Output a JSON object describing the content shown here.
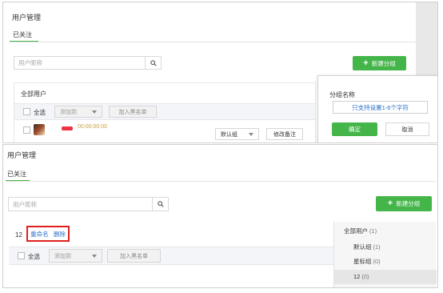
{
  "top": {
    "page_title": "用户管理",
    "tab_label": "已关注",
    "search_placeholder": "用户昵称",
    "new_group_label": "新建分组",
    "section_title": "全部用户",
    "select_all": "全选",
    "add_to": "添加到",
    "blacklist": "加入黑名单",
    "row": {
      "name_placeholder_digits": "00:00:00:00",
      "group_select": "默认组",
      "edit_note": "修改备注"
    },
    "popup": {
      "title": "分组名称",
      "input_value": "只支持设置1-6个字符",
      "confirm": "确定",
      "cancel": "取消"
    }
  },
  "bottom": {
    "page_title": "用户管理",
    "tab_label": "已关注",
    "search_placeholder": "用户昵称",
    "new_group_label": "新建分组",
    "group_name": "12",
    "rename": "重命名",
    "delete": "删除",
    "select_all": "全选",
    "add_to": "添加到",
    "blacklist": "加入黑名单",
    "side_groups": [
      {
        "name": "全部用户",
        "count": "(1)"
      },
      {
        "name": "默认组",
        "count": "(1)"
      },
      {
        "name": "星标组",
        "count": "(0)"
      },
      {
        "name": "12",
        "count": "(0)"
      }
    ]
  },
  "colors": {
    "accent_green": "#44b549",
    "link_blue": "#2a6fc9",
    "highlight_red": "#e02020"
  }
}
